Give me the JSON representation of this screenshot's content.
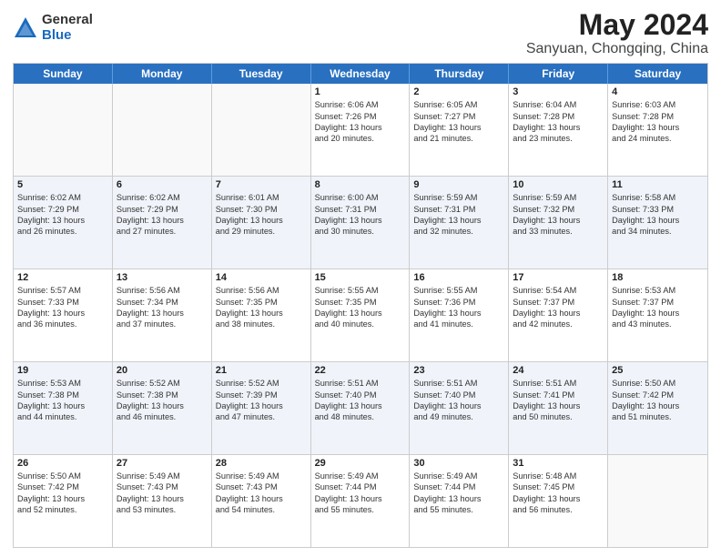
{
  "logo": {
    "general": "General",
    "blue": "Blue"
  },
  "title": "May 2024",
  "subtitle": "Sanyuan, Chongqing, China",
  "headers": [
    "Sunday",
    "Monday",
    "Tuesday",
    "Wednesday",
    "Thursday",
    "Friday",
    "Saturday"
  ],
  "rows": [
    {
      "alt": false,
      "cells": [
        {
          "day": "",
          "lines": []
        },
        {
          "day": "",
          "lines": []
        },
        {
          "day": "",
          "lines": []
        },
        {
          "day": "1",
          "lines": [
            "Sunrise: 6:06 AM",
            "Sunset: 7:26 PM",
            "Daylight: 13 hours",
            "and 20 minutes."
          ]
        },
        {
          "day": "2",
          "lines": [
            "Sunrise: 6:05 AM",
            "Sunset: 7:27 PM",
            "Daylight: 13 hours",
            "and 21 minutes."
          ]
        },
        {
          "day": "3",
          "lines": [
            "Sunrise: 6:04 AM",
            "Sunset: 7:28 PM",
            "Daylight: 13 hours",
            "and 23 minutes."
          ]
        },
        {
          "day": "4",
          "lines": [
            "Sunrise: 6:03 AM",
            "Sunset: 7:28 PM",
            "Daylight: 13 hours",
            "and 24 minutes."
          ]
        }
      ]
    },
    {
      "alt": true,
      "cells": [
        {
          "day": "5",
          "lines": [
            "Sunrise: 6:02 AM",
            "Sunset: 7:29 PM",
            "Daylight: 13 hours",
            "and 26 minutes."
          ]
        },
        {
          "day": "6",
          "lines": [
            "Sunrise: 6:02 AM",
            "Sunset: 7:29 PM",
            "Daylight: 13 hours",
            "and 27 minutes."
          ]
        },
        {
          "day": "7",
          "lines": [
            "Sunrise: 6:01 AM",
            "Sunset: 7:30 PM",
            "Daylight: 13 hours",
            "and 29 minutes."
          ]
        },
        {
          "day": "8",
          "lines": [
            "Sunrise: 6:00 AM",
            "Sunset: 7:31 PM",
            "Daylight: 13 hours",
            "and 30 minutes."
          ]
        },
        {
          "day": "9",
          "lines": [
            "Sunrise: 5:59 AM",
            "Sunset: 7:31 PM",
            "Daylight: 13 hours",
            "and 32 minutes."
          ]
        },
        {
          "day": "10",
          "lines": [
            "Sunrise: 5:59 AM",
            "Sunset: 7:32 PM",
            "Daylight: 13 hours",
            "and 33 minutes."
          ]
        },
        {
          "day": "11",
          "lines": [
            "Sunrise: 5:58 AM",
            "Sunset: 7:33 PM",
            "Daylight: 13 hours",
            "and 34 minutes."
          ]
        }
      ]
    },
    {
      "alt": false,
      "cells": [
        {
          "day": "12",
          "lines": [
            "Sunrise: 5:57 AM",
            "Sunset: 7:33 PM",
            "Daylight: 13 hours",
            "and 36 minutes."
          ]
        },
        {
          "day": "13",
          "lines": [
            "Sunrise: 5:56 AM",
            "Sunset: 7:34 PM",
            "Daylight: 13 hours",
            "and 37 minutes."
          ]
        },
        {
          "day": "14",
          "lines": [
            "Sunrise: 5:56 AM",
            "Sunset: 7:35 PM",
            "Daylight: 13 hours",
            "and 38 minutes."
          ]
        },
        {
          "day": "15",
          "lines": [
            "Sunrise: 5:55 AM",
            "Sunset: 7:35 PM",
            "Daylight: 13 hours",
            "and 40 minutes."
          ]
        },
        {
          "day": "16",
          "lines": [
            "Sunrise: 5:55 AM",
            "Sunset: 7:36 PM",
            "Daylight: 13 hours",
            "and 41 minutes."
          ]
        },
        {
          "day": "17",
          "lines": [
            "Sunrise: 5:54 AM",
            "Sunset: 7:37 PM",
            "Daylight: 13 hours",
            "and 42 minutes."
          ]
        },
        {
          "day": "18",
          "lines": [
            "Sunrise: 5:53 AM",
            "Sunset: 7:37 PM",
            "Daylight: 13 hours",
            "and 43 minutes."
          ]
        }
      ]
    },
    {
      "alt": true,
      "cells": [
        {
          "day": "19",
          "lines": [
            "Sunrise: 5:53 AM",
            "Sunset: 7:38 PM",
            "Daylight: 13 hours",
            "and 44 minutes."
          ]
        },
        {
          "day": "20",
          "lines": [
            "Sunrise: 5:52 AM",
            "Sunset: 7:38 PM",
            "Daylight: 13 hours",
            "and 46 minutes."
          ]
        },
        {
          "day": "21",
          "lines": [
            "Sunrise: 5:52 AM",
            "Sunset: 7:39 PM",
            "Daylight: 13 hours",
            "and 47 minutes."
          ]
        },
        {
          "day": "22",
          "lines": [
            "Sunrise: 5:51 AM",
            "Sunset: 7:40 PM",
            "Daylight: 13 hours",
            "and 48 minutes."
          ]
        },
        {
          "day": "23",
          "lines": [
            "Sunrise: 5:51 AM",
            "Sunset: 7:40 PM",
            "Daylight: 13 hours",
            "and 49 minutes."
          ]
        },
        {
          "day": "24",
          "lines": [
            "Sunrise: 5:51 AM",
            "Sunset: 7:41 PM",
            "Daylight: 13 hours",
            "and 50 minutes."
          ]
        },
        {
          "day": "25",
          "lines": [
            "Sunrise: 5:50 AM",
            "Sunset: 7:42 PM",
            "Daylight: 13 hours",
            "and 51 minutes."
          ]
        }
      ]
    },
    {
      "alt": false,
      "cells": [
        {
          "day": "26",
          "lines": [
            "Sunrise: 5:50 AM",
            "Sunset: 7:42 PM",
            "Daylight: 13 hours",
            "and 52 minutes."
          ]
        },
        {
          "day": "27",
          "lines": [
            "Sunrise: 5:49 AM",
            "Sunset: 7:43 PM",
            "Daylight: 13 hours",
            "and 53 minutes."
          ]
        },
        {
          "day": "28",
          "lines": [
            "Sunrise: 5:49 AM",
            "Sunset: 7:43 PM",
            "Daylight: 13 hours",
            "and 54 minutes."
          ]
        },
        {
          "day": "29",
          "lines": [
            "Sunrise: 5:49 AM",
            "Sunset: 7:44 PM",
            "Daylight: 13 hours",
            "and 55 minutes."
          ]
        },
        {
          "day": "30",
          "lines": [
            "Sunrise: 5:49 AM",
            "Sunset: 7:44 PM",
            "Daylight: 13 hours",
            "and 55 minutes."
          ]
        },
        {
          "day": "31",
          "lines": [
            "Sunrise: 5:48 AM",
            "Sunset: 7:45 PM",
            "Daylight: 13 hours",
            "and 56 minutes."
          ]
        },
        {
          "day": "",
          "lines": []
        }
      ]
    }
  ]
}
